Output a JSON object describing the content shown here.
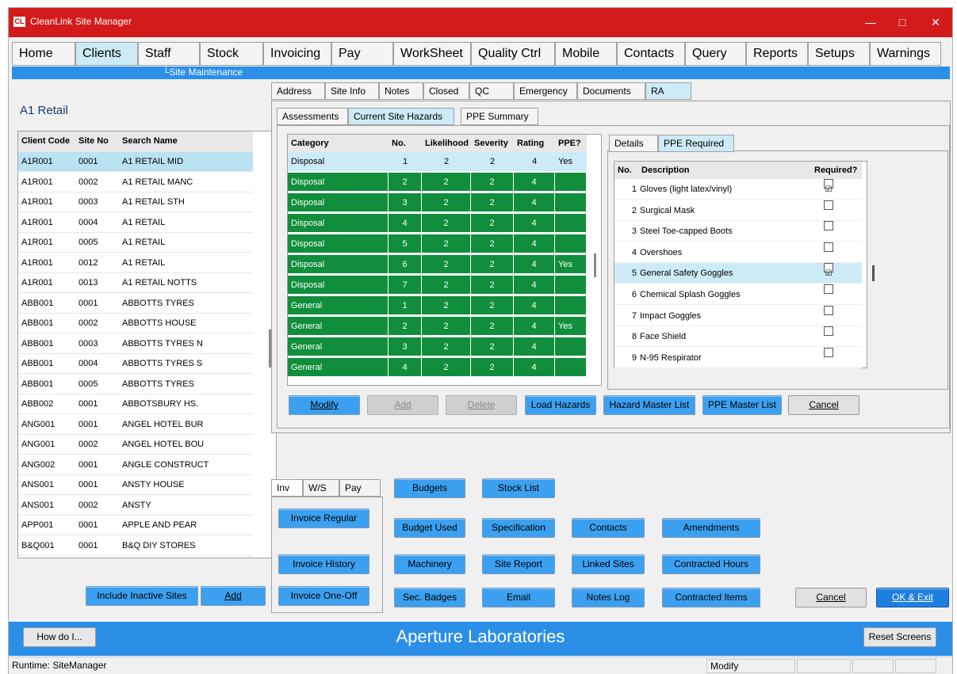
{
  "window": {
    "title": "CleanLink Site Manager",
    "logo": "CL",
    "controls": [
      "minimize-icon",
      "maximize-icon",
      "close-icon"
    ]
  },
  "menu": [
    "Home",
    "Clients",
    "Staff",
    "Stock",
    "Invoicing",
    "Pay",
    "WorkSheet",
    "Quality Ctrl",
    "Mobile",
    "Contacts",
    "Query",
    "Reports",
    "Setups",
    "Warnings"
  ],
  "breadcrumb": "└Site Maintenance",
  "site_title": "A1 Retail",
  "site_list": {
    "headers": [
      "Client Code",
      "Site No",
      "Search Name"
    ],
    "rows": [
      [
        "A1R001",
        "0001",
        "A1 RETAIL MID"
      ],
      [
        "A1R001",
        "0002",
        "A1 RETAIL MANC"
      ],
      [
        "A1R001",
        "0003",
        "A1 RETAIL STH"
      ],
      [
        "A1R001",
        "0004",
        "A1 RETAIL"
      ],
      [
        "A1R001",
        "0005",
        "A1 RETAIL"
      ],
      [
        "A1R001",
        "0012",
        "A1 RETAIL"
      ],
      [
        "A1R001",
        "0013",
        "A1 RETAIL NOTTS"
      ],
      [
        "ABB001",
        "0001",
        "ABBOTTS TYRES"
      ],
      [
        "ABB001",
        "0002",
        "ABBOTTS HOUSE"
      ],
      [
        "ABB001",
        "0003",
        "ABBOTTS TYRES N"
      ],
      [
        "ABB001",
        "0004",
        "ABBOTTS TYRES S"
      ],
      [
        "ABB001",
        "0005",
        "ABBOTTS TYRES"
      ],
      [
        "ABB002",
        "0001",
        "ABBOTSBURY HS."
      ],
      [
        "ANG001",
        "0001",
        "ANGEL HOTEL BUR"
      ],
      [
        "ANG001",
        "0002",
        "ANGEL HOTEL BOU"
      ],
      [
        "ANG002",
        "0001",
        "ANGLE CONSTRUCT"
      ],
      [
        "ANS001",
        "0001",
        "ANSTY HOUSE"
      ],
      [
        "ANS001",
        "0002",
        "ANSTY"
      ],
      [
        "APP001",
        "0001",
        "APPLE AND PEAR"
      ],
      [
        "B&Q001",
        "0001",
        "B&Q DIY STORES"
      ]
    ]
  },
  "left_buttons": {
    "include_inactive": "Include Inactive Sites",
    "add": "Add"
  },
  "site_tabs": [
    "Address",
    "Site Info",
    "Notes",
    "Closed",
    "QC",
    "Emergency",
    "Documents",
    "RA"
  ],
  "ra_tabs": [
    "Assessments",
    "Current Site Hazards",
    "PPE Summary"
  ],
  "hazards": {
    "headers": [
      "Category",
      "No.",
      "Likelihood",
      "Severity",
      "Rating",
      "PPE?"
    ],
    "rows": [
      [
        "Disposal",
        "1",
        "2",
        "2",
        "4",
        "Yes"
      ],
      [
        "Disposal",
        "2",
        "2",
        "2",
        "4",
        ""
      ],
      [
        "Disposal",
        "3",
        "2",
        "2",
        "4",
        ""
      ],
      [
        "Disposal",
        "4",
        "2",
        "2",
        "4",
        ""
      ],
      [
        "Disposal",
        "5",
        "2",
        "2",
        "4",
        ""
      ],
      [
        "Disposal",
        "6",
        "2",
        "2",
        "4",
        "Yes"
      ],
      [
        "Disposal",
        "7",
        "2",
        "2",
        "4",
        ""
      ],
      [
        "General",
        "1",
        "2",
        "2",
        "4",
        ""
      ],
      [
        "General",
        "2",
        "2",
        "2",
        "4",
        "Yes"
      ],
      [
        "General",
        "3",
        "2",
        "2",
        "4",
        ""
      ],
      [
        "General",
        "4",
        "2",
        "2",
        "4",
        ""
      ]
    ]
  },
  "detail_tabs": [
    "Details",
    "PPE Required"
  ],
  "ppe": {
    "headers": [
      "No.",
      "Description",
      "Required?"
    ],
    "rows": [
      {
        "no": "1",
        "desc": "Gloves (light latex/vinyl)",
        "req": "☑"
      },
      {
        "no": "2",
        "desc": "Surgical Mask",
        "req": ""
      },
      {
        "no": "3",
        "desc": "Steel Toe-capped Boots",
        "req": ""
      },
      {
        "no": "4",
        "desc": "Overshoes",
        "req": ""
      },
      {
        "no": "5",
        "desc": "General Safety Goggles",
        "req": "☑"
      },
      {
        "no": "6",
        "desc": "Chemical Splash Goggles",
        "req": ""
      },
      {
        "no": "7",
        "desc": "Impact Goggles",
        "req": ""
      },
      {
        "no": "8",
        "desc": "Face Shield",
        "req": ""
      },
      {
        "no": "9",
        "desc": "N-95 Respirator",
        "req": ""
      }
    ]
  },
  "hazard_buttons": {
    "modify": "Modify",
    "add": "Add",
    "delete": "Delete",
    "load_hazards": "Load Hazards",
    "hazard_master": "Hazard Master List",
    "ppe_master": "PPE Master List",
    "cancel": "Cancel"
  },
  "bottom_tabs": [
    "Inv",
    "W/S",
    "Pay"
  ],
  "inv_buttons": [
    "Invoice Regular",
    "Invoice History",
    "Invoice One-Off"
  ],
  "action_buttons": {
    "budgets": "Budgets",
    "stock_list": "Stock List",
    "budget_used": "Budget Used",
    "specification": "Specification",
    "contacts": "Contacts",
    "amendments": "Amendments",
    "machinery": "Machinery",
    "site_report": "Site Report",
    "linked_sites": "Linked Sites",
    "contracted_hours": "Contracted Hours",
    "sec_badges": "Sec. Badges",
    "email": "Email",
    "notes_log": "Notes Log",
    "contracted_items": "Contracted Items",
    "cancel": "Cancel",
    "ok_exit": "OK & Exit"
  },
  "footer": {
    "how_do_i": "How do I...",
    "brand": "Aperture Laboratories",
    "reset": "Reset Screens"
  },
  "status": {
    "runtime": "Runtime: SiteManager",
    "mode": "Modify"
  },
  "colors": {
    "title_bar": "#d41b1b",
    "accent_blue": "#2b8fe8",
    "hazard_green": "#108e3c",
    "selected_row": "#cdebf7"
  }
}
